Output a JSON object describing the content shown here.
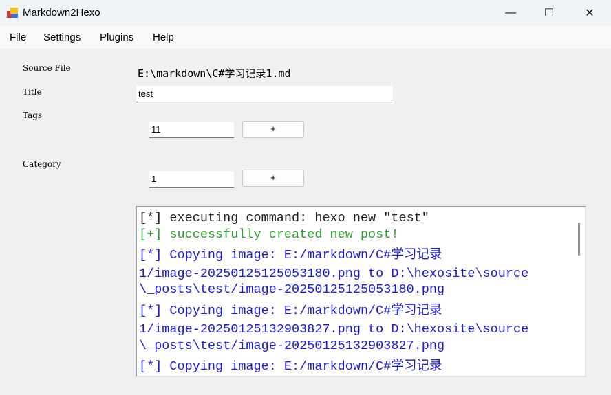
{
  "window": {
    "title": "Markdown2Hexo",
    "minimize": "—",
    "maximize": "☐",
    "close": "✕"
  },
  "menu": [
    "File",
    "Settings",
    "Plugins",
    "Help"
  ],
  "form": {
    "source_label": "Source File",
    "source_value": "E:\\markdown\\C#学习记录1.md",
    "title_label": "Title",
    "title_value": "test",
    "tags_label": "Tags",
    "tags_value": "11",
    "tags_add": "+",
    "category_label": "Category",
    "category_value": "1",
    "category_add": "+"
  },
  "colors": {
    "info": "#222222",
    "success": "#2e9e2e",
    "copy": "#1a1adc"
  },
  "log": [
    {
      "text": "[*] executing command: hexo new \"test\"",
      "type": "info"
    },
    {
      "text": "[+] successfully created new post!",
      "type": "success"
    },
    {
      "text": "[*] Copying image: E:/markdown/C#学习记录",
      "type": "copy"
    },
    {
      "text": "1/image-20250125125053180.png to D:\\hexosite\\source",
      "type": "copy"
    },
    {
      "text": "\\_posts\\test/image-20250125125053180.png",
      "type": "copy"
    },
    {
      "text": "[*] Copying image: E:/markdown/C#学习记录",
      "type": "copy"
    },
    {
      "text": "1/image-20250125132903827.png to D:\\hexosite\\source",
      "type": "copy"
    },
    {
      "text": "\\_posts\\test/image-20250125132903827.png",
      "type": "copy"
    },
    {
      "text": "[*] Copying image: E:/markdown/C#学习记录",
      "type": "copy"
    }
  ]
}
